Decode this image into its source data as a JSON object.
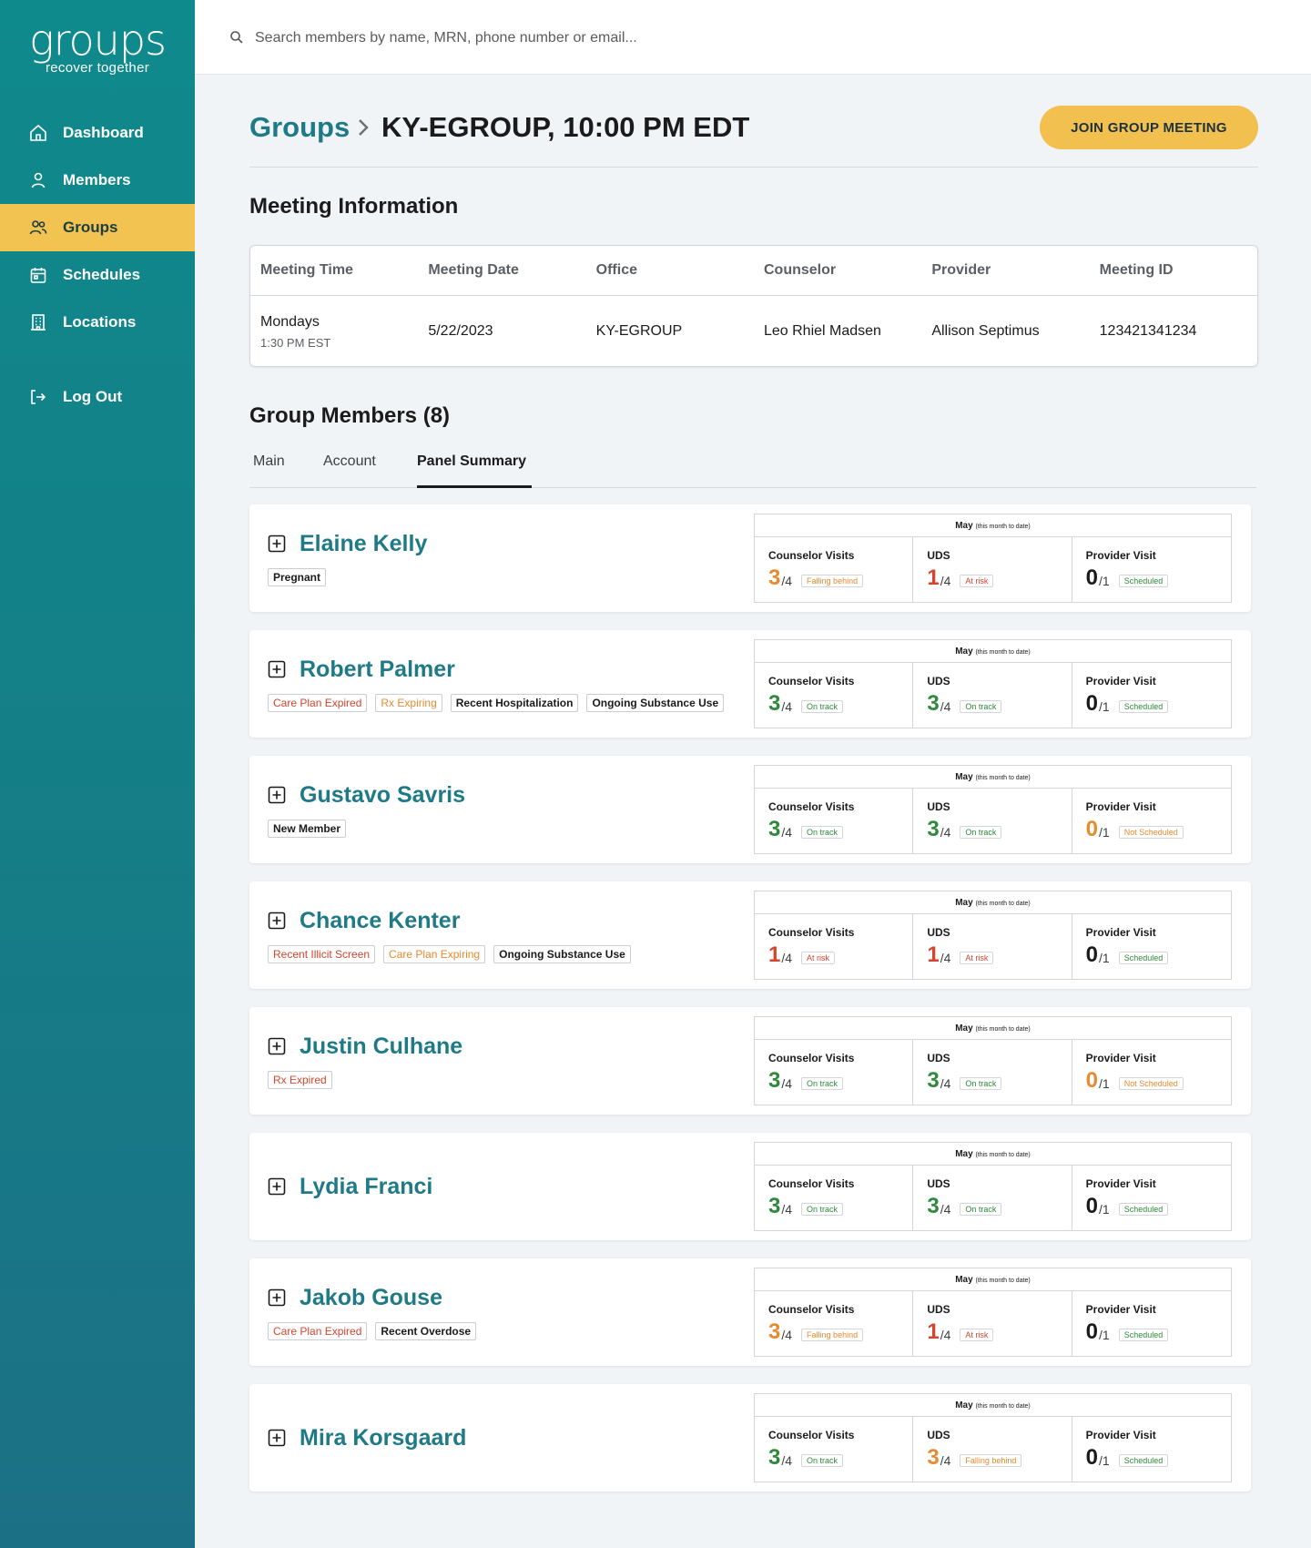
{
  "brand": {
    "wordmark": "groups",
    "tagline": "recover together"
  },
  "nav": [
    {
      "label": "Dashboard",
      "icon": "home-icon"
    },
    {
      "label": "Members",
      "icon": "user-icon"
    },
    {
      "label": "Groups",
      "icon": "users-icon",
      "active": true
    },
    {
      "label": "Schedules",
      "icon": "calendar-icon"
    },
    {
      "label": "Locations",
      "icon": "building-icon"
    },
    {
      "label": "Log Out",
      "icon": "logout-icon"
    }
  ],
  "search": {
    "placeholder": "Search members by name, MRN, phone number or email..."
  },
  "breadcrumb": {
    "parent": "Groups",
    "current": "KY-EGROUP, 10:00 PM EDT"
  },
  "join_button": "JOIN GROUP MEETING",
  "meeting_info": {
    "title": "Meeting Information",
    "headers": [
      "Meeting Time",
      "Meeting Date",
      "Office",
      "Counselor",
      "Provider",
      "Meeting ID"
    ],
    "time": "Mondays",
    "time_sub": "1:30 PM EST",
    "date": "5/22/2023",
    "office": "KY-EGROUP",
    "counselor": "Leo Rhiel Madsen",
    "provider": "Allison Septimus",
    "meeting_id": "123421341234"
  },
  "group_members": {
    "title": "Group Members (8)",
    "tabs": [
      "Main",
      "Account",
      "Panel Summary"
    ],
    "active_tab": "Panel Summary",
    "summary_month": "May",
    "summary_month_note": "(this month to date)",
    "metric_labels": [
      "Counselor Visits",
      "UDS",
      "Provider Visit"
    ],
    "members": [
      {
        "name": "Elaine Kelly",
        "tags": [
          {
            "text": "Pregnant",
            "tone": "neutral"
          }
        ],
        "metrics": [
          {
            "value": "3",
            "den": "/4",
            "status": "Falling behind",
            "tone": "orange"
          },
          {
            "value": "1",
            "den": "/4",
            "status": "At risk",
            "tone": "red"
          },
          {
            "value": "0",
            "den": "/1",
            "status": "Scheduled",
            "tone": "black"
          }
        ]
      },
      {
        "name": "Robert Palmer",
        "tags": [
          {
            "text": "Care Plan Expired",
            "tone": "red"
          },
          {
            "text": "Rx Expiring",
            "tone": "orange"
          },
          {
            "text": "Recent Hospitalization",
            "tone": "neutral"
          },
          {
            "text": "Ongoing Substance Use",
            "tone": "neutral"
          }
        ],
        "metrics": [
          {
            "value": "3",
            "den": "/4",
            "status": "On track",
            "tone": "green"
          },
          {
            "value": "3",
            "den": "/4",
            "status": "On track",
            "tone": "green"
          },
          {
            "value": "0",
            "den": "/1",
            "status": "Scheduled",
            "tone": "black"
          }
        ]
      },
      {
        "name": "Gustavo Savris",
        "tags": [
          {
            "text": "New Member",
            "tone": "neutral"
          }
        ],
        "metrics": [
          {
            "value": "3",
            "den": "/4",
            "status": "On track",
            "tone": "green"
          },
          {
            "value": "3",
            "den": "/4",
            "status": "On track",
            "tone": "green"
          },
          {
            "value": "0",
            "den": "/1",
            "status": "Not Scheduled",
            "tone": "orange"
          }
        ]
      },
      {
        "name": "Chance Kenter",
        "tags": [
          {
            "text": "Recent Illicit Screen",
            "tone": "red"
          },
          {
            "text": "Care Plan Expiring",
            "tone": "orange"
          },
          {
            "text": "Ongoing Substance Use",
            "tone": "neutral"
          }
        ],
        "metrics": [
          {
            "value": "1",
            "den": "/4",
            "status": "At risk",
            "tone": "red"
          },
          {
            "value": "1",
            "den": "/4",
            "status": "At risk",
            "tone": "red"
          },
          {
            "value": "0",
            "den": "/1",
            "status": "Scheduled",
            "tone": "black"
          }
        ]
      },
      {
        "name": "Justin Culhane",
        "tags": [
          {
            "text": "Rx Expired",
            "tone": "red"
          }
        ],
        "metrics": [
          {
            "value": "3",
            "den": "/4",
            "status": "On track",
            "tone": "green"
          },
          {
            "value": "3",
            "den": "/4",
            "status": "On track",
            "tone": "green"
          },
          {
            "value": "0",
            "den": "/1",
            "status": "Not Scheduled",
            "tone": "orange"
          }
        ]
      },
      {
        "name": "Lydia Franci",
        "tags": [],
        "metrics": [
          {
            "value": "3",
            "den": "/4",
            "status": "On track",
            "tone": "green"
          },
          {
            "value": "3",
            "den": "/4",
            "status": "On track",
            "tone": "green"
          },
          {
            "value": "0",
            "den": "/1",
            "status": "Scheduled",
            "tone": "black"
          }
        ]
      },
      {
        "name": "Jakob Gouse",
        "tags": [
          {
            "text": "Care Plan Expired",
            "tone": "red"
          },
          {
            "text": "Recent Overdose",
            "tone": "neutral"
          }
        ],
        "metrics": [
          {
            "value": "3",
            "den": "/4",
            "status": "Falling behind",
            "tone": "orange"
          },
          {
            "value": "1",
            "den": "/4",
            "status": "At risk",
            "tone": "red"
          },
          {
            "value": "0",
            "den": "/1",
            "status": "Scheduled",
            "tone": "black"
          }
        ]
      },
      {
        "name": "Mira Korsgaard",
        "tags": [],
        "metrics": [
          {
            "value": "3",
            "den": "/4",
            "status": "On track",
            "tone": "green"
          },
          {
            "value": "3",
            "den": "/4",
            "status": "Falling behind",
            "tone": "orange"
          },
          {
            "value": "0",
            "den": "/1",
            "status": "Scheduled",
            "tone": "black"
          }
        ]
      }
    ]
  },
  "colors": {
    "teal": "#1f7a87",
    "accent": "#f2c04e",
    "green": "#2e8a3a",
    "orange": "#e88a2e",
    "red": "#d4452e"
  }
}
